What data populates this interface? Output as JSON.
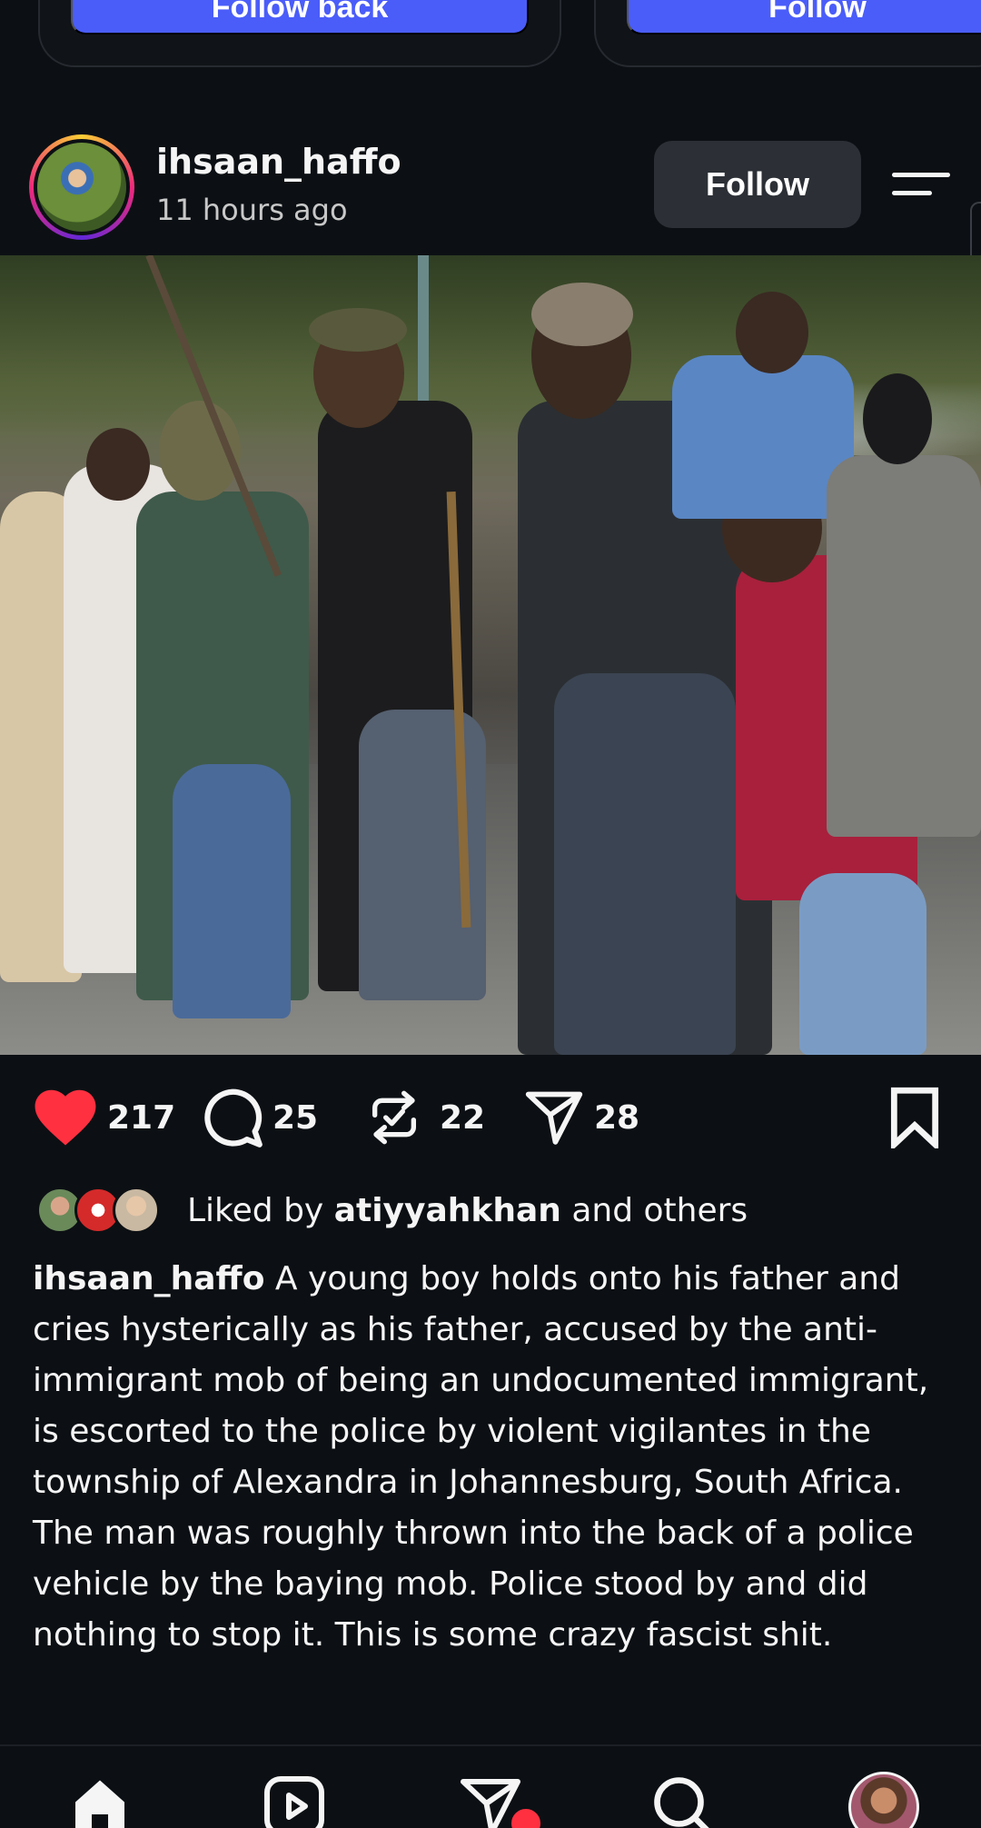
{
  "top_suggestions": {
    "follow_back_label": "Follow back",
    "follow_label": "Follow"
  },
  "post": {
    "username": "ihsaan_haffo",
    "timestamp": "11 hours ago",
    "follow_label": "Follow",
    "actions": {
      "likes": "217",
      "comments": "25",
      "reposts": "22",
      "shares": "28"
    },
    "liked_by": {
      "prefix": "Liked by",
      "user": "atiyyahkhan",
      "suffix": "and others"
    },
    "caption": {
      "user": "ihsaan_haffo",
      "text": "A young boy holds onto his father and cries hysterically as his father, accused by the anti-immigrant mob of being an undocumented immigrant, is escorted to the police by violent vigilantes in the township of Alexandra in Johannesburg, South Africa. The man was roughly thrown into the back of a police vehicle by the baying mob. Police stood by and did nothing to stop it.  This is some crazy fascist shit."
    }
  },
  "icons": {
    "like": "heart-icon",
    "comment": "comment-icon",
    "repost": "repost-icon",
    "share": "send-icon",
    "save": "bookmark-icon",
    "menu": "menu-icon"
  },
  "colors": {
    "background": "#0c1014",
    "like_red": "#ff3040",
    "follow_blue": "#4a5df9",
    "button_gray": "#2c3036"
  },
  "bottom_nav": {
    "items": [
      "home-icon",
      "reels-icon",
      "messages-icon",
      "search-icon",
      "profile-avatar"
    ]
  }
}
